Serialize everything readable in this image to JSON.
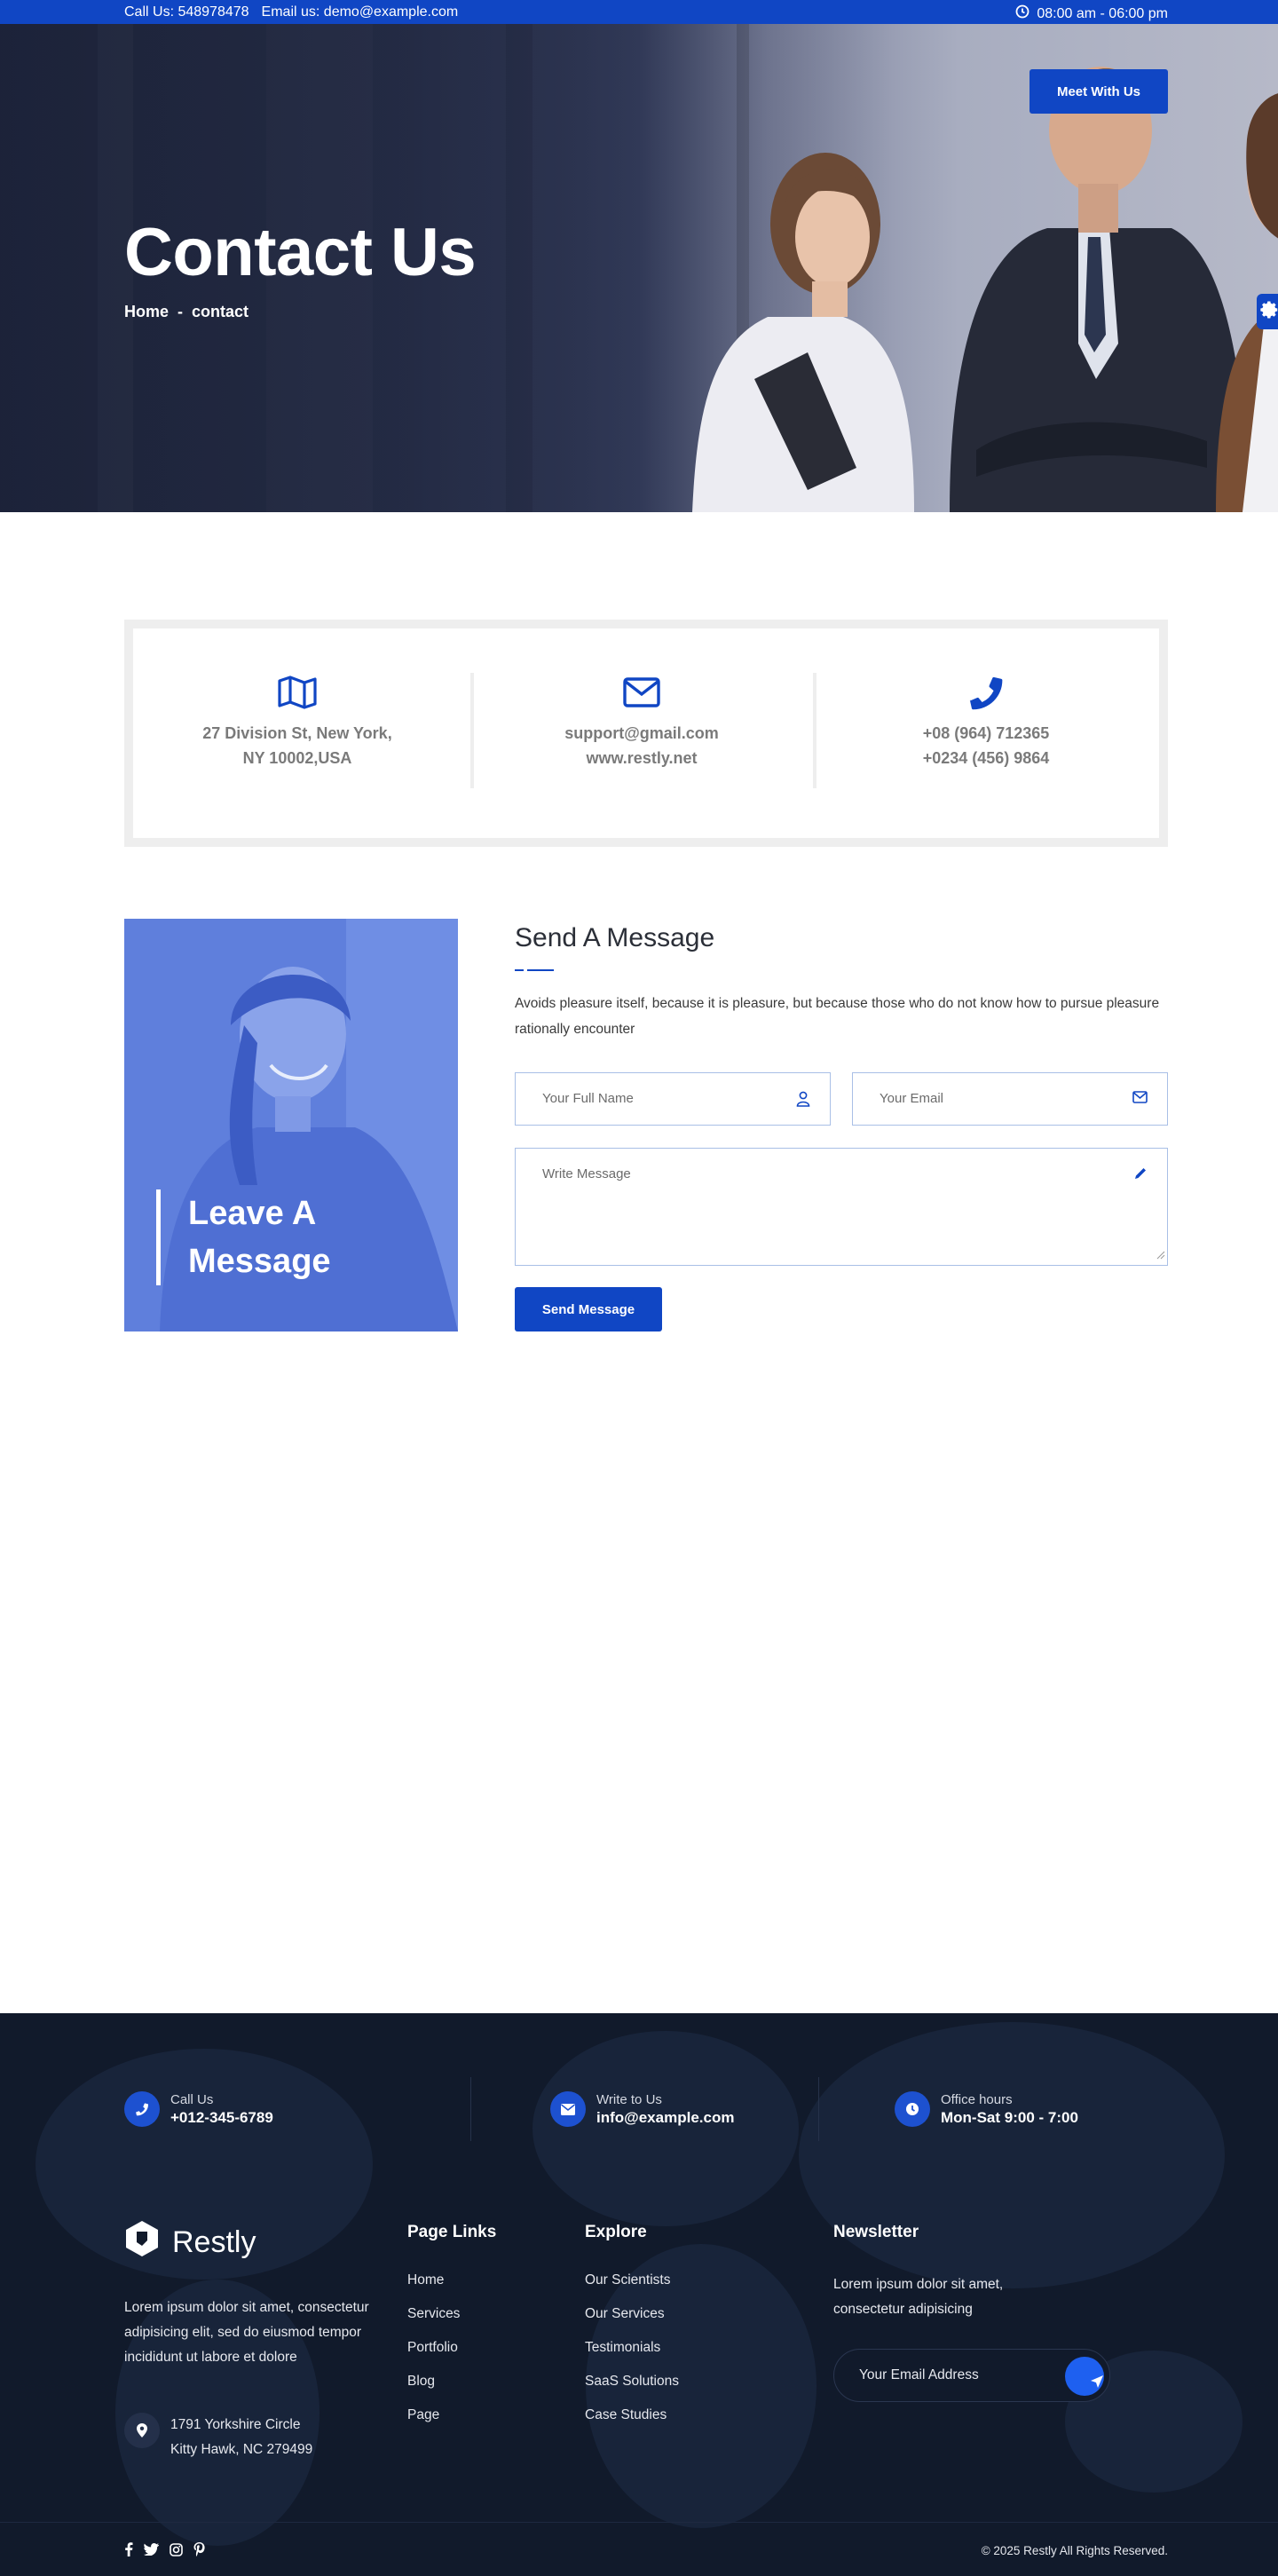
{
  "colors": {
    "brand": "#1046c4",
    "footer_bg": "#111a2b",
    "white": "#ffffff"
  },
  "topbar": {
    "call": "Call Us: 548978478",
    "email": "Email us: demo@example.com",
    "hours": "08:00 am - 06:00 pm",
    "hours_icon": "clock-icon"
  },
  "hero": {
    "title": "Contact Us",
    "breadcrumb_home": "Home",
    "breadcrumb_sep": "-",
    "breadcrumb_current": "contact",
    "cta_label": "Meet With Us",
    "settings_icon": "gear-icon"
  },
  "info": [
    {
      "icon": "map-icon",
      "line1": "27 Division St, New York,",
      "line2": "NY 10002,USA"
    },
    {
      "icon": "envelope-icon",
      "line1": "support@gmail.com",
      "line2": "www.restly.net"
    },
    {
      "icon": "phone-icon",
      "line1": "+08 (964) 712365",
      "line2": "+0234 (456) 9864"
    }
  ],
  "leave": {
    "line1": "Leave A",
    "line2": "Message"
  },
  "message": {
    "title": "Send A Message",
    "description": "Avoids pleasure itself, because it is pleasure, but because those who do not know how to pursue pleasure rationally encounter",
    "name_placeholder": "Your Full Name",
    "email_placeholder": "Your Email",
    "message_placeholder": "Write Message",
    "submit_label": "Send Message"
  },
  "footer": {
    "contacts": [
      {
        "icon": "phone-icon",
        "label": "Call Us",
        "value": "+012-345-6789"
      },
      {
        "icon": "envelope-icon",
        "label": "Write to Us",
        "value": "info@example.com"
      },
      {
        "icon": "clock-icon",
        "label": "Office hours",
        "value": "Mon-Sat 9:00 - 7:00"
      }
    ],
    "brand_name": "Restly",
    "brand_desc": "Lorem ipsum dolor sit amet, consectetur adipisicing elit, sed do eiusmod tempor incididunt ut labore et dolore",
    "address_line1": "1791 Yorkshire Circle",
    "address_line2": "Kitty Hawk, NC 279499",
    "page_links_title": "Page Links",
    "page_links": [
      "Home",
      "Services",
      "Portfolio",
      "Blog",
      "Page"
    ],
    "explore_title": "Explore",
    "explore_links": [
      "Our Scientists",
      "Our Services",
      "Testimonials",
      "SaaS Solutions",
      "Case Studies"
    ],
    "newsletter_title": "Newsletter",
    "newsletter_desc": "Lorem ipsum dolor sit amet, consectetur adipisicing",
    "newsletter_placeholder": "Your Email Address",
    "social_icons": [
      "facebook-icon",
      "twitter-icon",
      "instagram-icon",
      "pinterest-icon"
    ],
    "copyright": "© 2025 Restly All Rights Reserved."
  }
}
